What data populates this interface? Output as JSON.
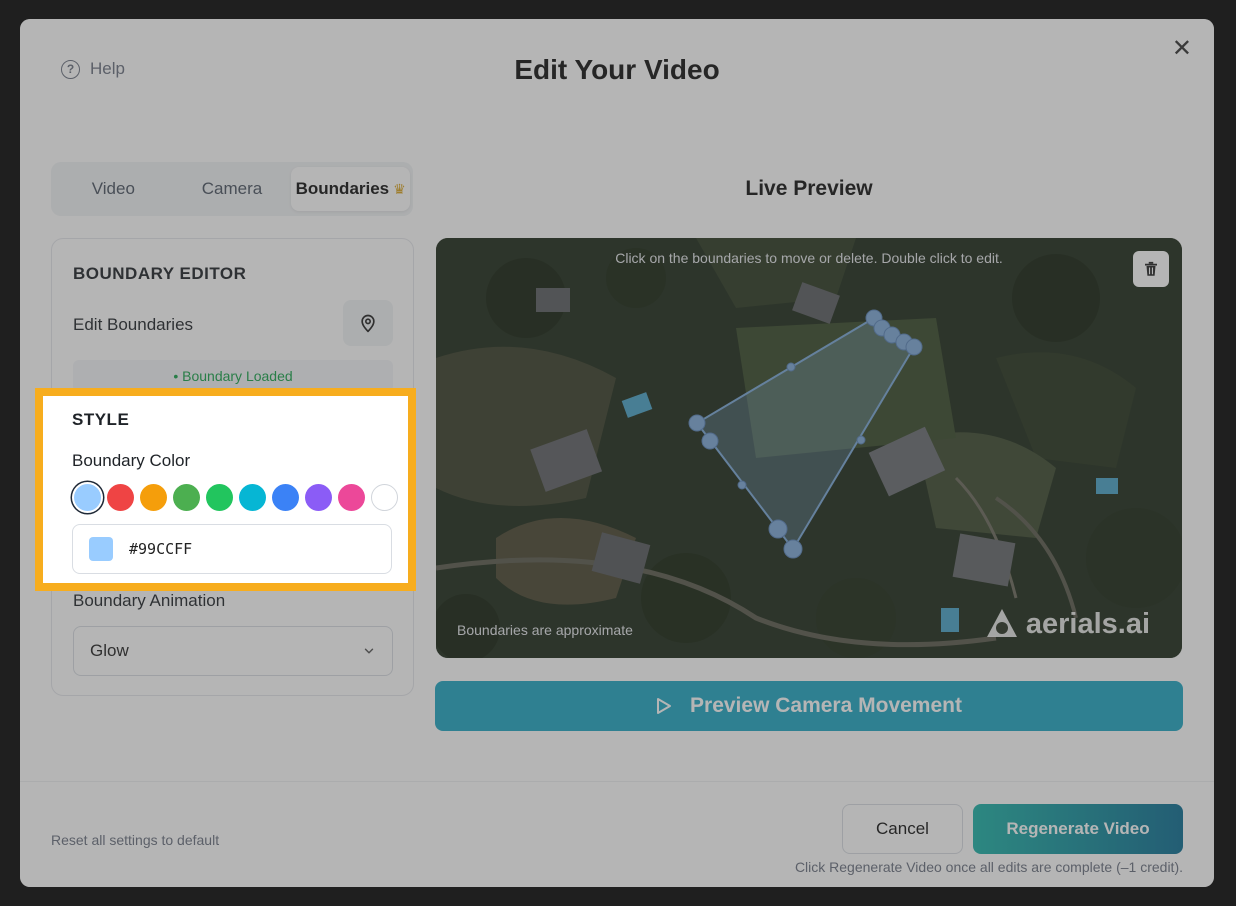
{
  "header": {
    "help_label": "Help",
    "title": "Edit Your Video",
    "close_symbol": "✕"
  },
  "tabs": [
    {
      "label": "Video"
    },
    {
      "label": "Camera"
    },
    {
      "label": "Boundaries",
      "badge_icon": "crown-icon",
      "active": true
    }
  ],
  "editor": {
    "section_title": "BOUNDARY EDITOR",
    "edit_label": "Edit Boundaries",
    "edit_icon": "map-pin-icon",
    "status": "• Boundary Loaded"
  },
  "style": {
    "section_title": "STYLE",
    "color_label": "Boundary Color",
    "colors": [
      "#99CCFF",
      "#EF4444",
      "#F59E0B",
      "#4CAF50",
      "#22C55E",
      "#06B6D4",
      "#3B82F6",
      "#8B5CF6",
      "#EC4899",
      "#FFFFFF"
    ],
    "selected_color": "#99CCFF",
    "hex_value": "#99CCFF",
    "animation_label": "Boundary Animation",
    "animation_value": "Glow"
  },
  "preview": {
    "title": "Live Preview",
    "hint": "Click on the boundaries to move or delete. Double click to edit.",
    "approx_note": "Boundaries are approximate",
    "watermark": "aerials.ai",
    "trash_icon": "trash-icon",
    "button_label": "Preview Camera Movement"
  },
  "footer": {
    "reset_label": "Reset all settings to default",
    "cancel_label": "Cancel",
    "regenerate_label": "Regenerate Video",
    "credit_note": "Click Regenerate Video once all edits are complete (–1 credit)."
  }
}
